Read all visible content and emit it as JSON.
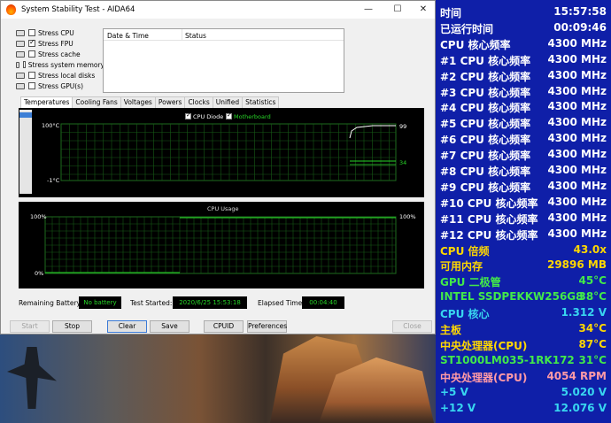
{
  "window": {
    "title": "System Stability Test - AIDA64",
    "min_glyph": "—",
    "max_glyph": "☐",
    "close_glyph": "✕"
  },
  "stress_options": [
    {
      "label": "Stress CPU",
      "checked": false,
      "icon": "cpu-icon"
    },
    {
      "label": "Stress FPU",
      "checked": true,
      "icon": "fpu-icon"
    },
    {
      "label": "Stress cache",
      "checked": false,
      "icon": "cache-icon"
    },
    {
      "label": "Stress system memory",
      "checked": false,
      "icon": "memory-icon"
    },
    {
      "label": "Stress local disks",
      "checked": false,
      "icon": "disk-icon"
    },
    {
      "label": "Stress GPU(s)",
      "checked": false,
      "icon": "gpu-icon"
    }
  ],
  "log": {
    "col_datetime": "Date & Time",
    "col_status": "Status"
  },
  "tabs": [
    "Temperatures",
    "Cooling Fans",
    "Voltages",
    "Powers",
    "Clocks",
    "Unified",
    "Statistics"
  ],
  "active_tab": "Temperatures",
  "temp_graph": {
    "legend": [
      {
        "name": "CPU Diode",
        "color": "#ffffff"
      },
      {
        "name": "Motherboard",
        "color": "#27d627"
      }
    ],
    "y_top_label": "100°C",
    "y_bottom_label": "-1°C",
    "value_cpu": "99",
    "value_mb": "34"
  },
  "cpu_graph": {
    "title": "CPU Usage",
    "y_top_label": "100%",
    "y_bottom_label": "0%",
    "value": "100%"
  },
  "status": {
    "battery_label": "Remaining Battery:",
    "battery_value": "No battery",
    "started_label": "Test Started:",
    "started_value": "2020/6/25 15:53:18",
    "elapsed_label": "Elapsed Time:",
    "elapsed_value": "00:04:40"
  },
  "buttons": {
    "start": "Start",
    "stop": "Stop",
    "clear": "Clear",
    "save": "Save",
    "cpuid": "CPUID",
    "preferences": "Preferences",
    "close": "Close"
  },
  "osd": [
    {
      "label": "时间",
      "value": "15:57:58",
      "color": "#ffffff"
    },
    {
      "label": "已运行时间",
      "value": "00:09:46",
      "color": "#ffffff"
    },
    {
      "label": "CPU 核心频率",
      "value": "4300 MHz",
      "color": "#ffffff"
    },
    {
      "label": "#1 CPU 核心频率",
      "value": "4300 MHz",
      "color": "#ffffff"
    },
    {
      "label": "#2 CPU 核心频率",
      "value": "4300 MHz",
      "color": "#ffffff"
    },
    {
      "label": "#3 CPU 核心频率",
      "value": "4300 MHz",
      "color": "#ffffff"
    },
    {
      "label": "#4 CPU 核心频率",
      "value": "4300 MHz",
      "color": "#ffffff"
    },
    {
      "label": "#5 CPU 核心频率",
      "value": "4300 MHz",
      "color": "#ffffff"
    },
    {
      "label": "#6 CPU 核心频率",
      "value": "4300 MHz",
      "color": "#ffffff"
    },
    {
      "label": "#7 CPU 核心频率",
      "value": "4300 MHz",
      "color": "#ffffff"
    },
    {
      "label": "#8 CPU 核心频率",
      "value": "4300 MHz",
      "color": "#ffffff"
    },
    {
      "label": "#9 CPU 核心频率",
      "value": "4300 MHz",
      "color": "#ffffff"
    },
    {
      "label": "#10 CPU 核心频率",
      "value": "4300 MHz",
      "color": "#ffffff"
    },
    {
      "label": "#11 CPU 核心频率",
      "value": "4300 MHz",
      "color": "#ffffff"
    },
    {
      "label": "#12 CPU 核心频率",
      "value": "4300 MHz",
      "color": "#ffffff"
    },
    {
      "label": "CPU 倍频",
      "value": "43.0x",
      "color": "#ffd700"
    },
    {
      "label": "可用内存",
      "value": "29896 MB",
      "color": "#ffd700"
    },
    {
      "label": "GPU 二极管",
      "value": "45°C",
      "color": "#42e84a"
    },
    {
      "label": "INTEL SSDPEKKW256G8",
      "value": "38°C",
      "color": "#42e84a"
    },
    {
      "label": "CPU 核心",
      "value": "1.312 V",
      "color": "#38d6f0"
    },
    {
      "label": "主板",
      "value": "34°C",
      "color": "#ffd700"
    },
    {
      "label": "中央处理器(CPU)",
      "value": "87°C",
      "color": "#ffd700"
    },
    {
      "label": "ST1000LM035-1RK172",
      "value": "31°C",
      "color": "#42e84a"
    },
    {
      "label": "中央处理器(CPU)",
      "value": "4054 RPM",
      "color": "#ff9aa6"
    },
    {
      "label": "+5 V",
      "value": "5.020 V",
      "color": "#38d6f0"
    },
    {
      "label": "+12 V",
      "value": "12.076 V",
      "color": "#38d6f0"
    }
  ]
}
